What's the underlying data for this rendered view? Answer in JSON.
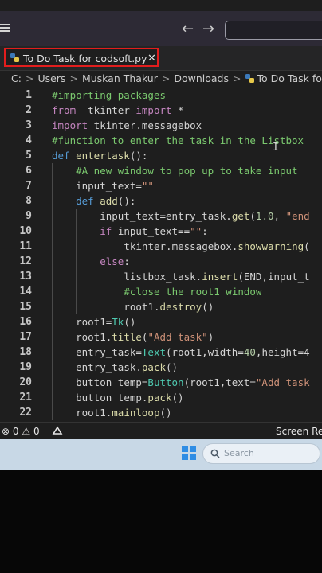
{
  "window": {
    "tab_title": "To Do Task for codsoft.py",
    "tab_close": "✕",
    "back_arrow": "←",
    "forward_arrow": "→"
  },
  "breadcrumb": [
    "C:",
    "Users",
    "Muskan Thakur",
    "Downloads",
    "To Do Task for codsoft.py"
  ],
  "breadcrumb_separator": ">",
  "editor": {
    "lines": [
      {
        "n": "1",
        "indent": 0,
        "tokens": [
          {
            "t": "#importing packages",
            "c": "#7bc96f"
          }
        ]
      },
      {
        "n": "2",
        "indent": 0,
        "tokens": [
          {
            "t": "from",
            "c": "#c586c0"
          },
          {
            "t": "  tkinter ",
            "c": "#d4d4d4"
          },
          {
            "t": "import",
            "c": "#c586c0"
          },
          {
            "t": " *",
            "c": "#d4d4d4"
          }
        ]
      },
      {
        "n": "3",
        "indent": 0,
        "tokens": [
          {
            "t": "import",
            "c": "#c586c0"
          },
          {
            "t": " tkinter.messagebox",
            "c": "#d4d4d4"
          }
        ]
      },
      {
        "n": "4",
        "indent": 0,
        "tokens": [
          {
            "t": "#function to enter the task in the Listbox",
            "c": "#7bc96f"
          }
        ]
      },
      {
        "n": "5",
        "indent": 0,
        "tokens": [
          {
            "t": "def",
            "c": "#569cd6"
          },
          {
            "t": " entertask",
            "c": "#dcdcaa"
          },
          {
            "t": "():",
            "c": "#d4d4d4"
          }
        ]
      },
      {
        "n": "6",
        "indent": 1,
        "tokens": [
          {
            "t": "#A new window to pop up to take input",
            "c": "#7bc96f"
          }
        ]
      },
      {
        "n": "7",
        "indent": 1,
        "tokens": [
          {
            "t": "input_text",
            "c": "#d4d4d4"
          },
          {
            "t": "=",
            "c": "#d4d4d4"
          },
          {
            "t": "\"\"",
            "c": "#ce9178"
          }
        ]
      },
      {
        "n": "8",
        "indent": 1,
        "tokens": [
          {
            "t": "def",
            "c": "#569cd6"
          },
          {
            "t": " add",
            "c": "#dcdcaa"
          },
          {
            "t": "():",
            "c": "#d4d4d4"
          }
        ]
      },
      {
        "n": "9",
        "indent": 2,
        "tokens": [
          {
            "t": "input_text",
            "c": "#d4d4d4"
          },
          {
            "t": "=entry_task.",
            "c": "#d4d4d4"
          },
          {
            "t": "get",
            "c": "#dcdcaa"
          },
          {
            "t": "(",
            "c": "#d4d4d4"
          },
          {
            "t": "1.0",
            "c": "#b5cea8"
          },
          {
            "t": ", ",
            "c": "#d4d4d4"
          },
          {
            "t": "\"end",
            "c": "#ce9178"
          }
        ]
      },
      {
        "n": "10",
        "indent": 2,
        "tokens": [
          {
            "t": "if",
            "c": "#c586c0"
          },
          {
            "t": " input_text==",
            "c": "#d4d4d4"
          },
          {
            "t": "\"\"",
            "c": "#ce9178"
          },
          {
            "t": ":",
            "c": "#d4d4d4"
          }
        ]
      },
      {
        "n": "11",
        "indent": 3,
        "tokens": [
          {
            "t": "tkinter.messagebox.",
            "c": "#d4d4d4"
          },
          {
            "t": "showwarning",
            "c": "#dcdcaa"
          },
          {
            "t": "(",
            "c": "#d4d4d4"
          }
        ]
      },
      {
        "n": "12",
        "indent": 2,
        "tokens": [
          {
            "t": "else",
            "c": "#c586c0"
          },
          {
            "t": ":",
            "c": "#d4d4d4"
          }
        ]
      },
      {
        "n": "13",
        "indent": 3,
        "tokens": [
          {
            "t": "listbox_task.",
            "c": "#d4d4d4"
          },
          {
            "t": "insert",
            "c": "#dcdcaa"
          },
          {
            "t": "(END,input_t",
            "c": "#d4d4d4"
          }
        ]
      },
      {
        "n": "14",
        "indent": 3,
        "tokens": [
          {
            "t": "#close the root1 window",
            "c": "#7bc96f"
          }
        ]
      },
      {
        "n": "15",
        "indent": 3,
        "tokens": [
          {
            "t": "root1.",
            "c": "#d4d4d4"
          },
          {
            "t": "destroy",
            "c": "#dcdcaa"
          },
          {
            "t": "()",
            "c": "#d4d4d4"
          }
        ]
      },
      {
        "n": "16",
        "indent": 1,
        "tokens": [
          {
            "t": "root1=",
            "c": "#d4d4d4"
          },
          {
            "t": "Tk",
            "c": "#4ec9b0"
          },
          {
            "t": "()",
            "c": "#d4d4d4"
          }
        ]
      },
      {
        "n": "17",
        "indent": 1,
        "tokens": [
          {
            "t": "root1.",
            "c": "#d4d4d4"
          },
          {
            "t": "title",
            "c": "#dcdcaa"
          },
          {
            "t": "(",
            "c": "#d4d4d4"
          },
          {
            "t": "\"Add task\"",
            "c": "#ce9178"
          },
          {
            "t": ")",
            "c": "#d4d4d4"
          }
        ]
      },
      {
        "n": "18",
        "indent": 1,
        "tokens": [
          {
            "t": "entry_task=",
            "c": "#d4d4d4"
          },
          {
            "t": "Text",
            "c": "#4ec9b0"
          },
          {
            "t": "(root1,width=",
            "c": "#d4d4d4"
          },
          {
            "t": "40",
            "c": "#b5cea8"
          },
          {
            "t": ",height=4",
            "c": "#d4d4d4"
          }
        ]
      },
      {
        "n": "19",
        "indent": 1,
        "tokens": [
          {
            "t": "entry_task.",
            "c": "#d4d4d4"
          },
          {
            "t": "pack",
            "c": "#dcdcaa"
          },
          {
            "t": "()",
            "c": "#d4d4d4"
          }
        ]
      },
      {
        "n": "20",
        "indent": 1,
        "tokens": [
          {
            "t": "button_temp=",
            "c": "#d4d4d4"
          },
          {
            "t": "Button",
            "c": "#4ec9b0"
          },
          {
            "t": "(root1,text=",
            "c": "#d4d4d4"
          },
          {
            "t": "\"Add task",
            "c": "#ce9178"
          }
        ]
      },
      {
        "n": "21",
        "indent": 1,
        "tokens": [
          {
            "t": "button_temp.",
            "c": "#d4d4d4"
          },
          {
            "t": "pack",
            "c": "#dcdcaa"
          },
          {
            "t": "()",
            "c": "#d4d4d4"
          }
        ]
      },
      {
        "n": "22",
        "indent": 1,
        "tokens": [
          {
            "t": "root1.",
            "c": "#d4d4d4"
          },
          {
            "t": "mainloop",
            "c": "#dcdcaa"
          },
          {
            "t": "()",
            "c": "#d4d4d4"
          }
        ]
      }
    ]
  },
  "statusbar": {
    "errors": "0",
    "warnings": "0",
    "right_text": "Screen Rea"
  },
  "taskbar": {
    "search_placeholder": "Search"
  },
  "colors": {
    "editor_bg": "#1e1e1e",
    "tab_highlight": "#e21d1d",
    "comment": "#7bc96f",
    "keyword": "#c586c0",
    "def_keyword": "#569cd6",
    "function": "#dcdcaa",
    "string": "#ce9178",
    "class": "#4ec9b0"
  }
}
